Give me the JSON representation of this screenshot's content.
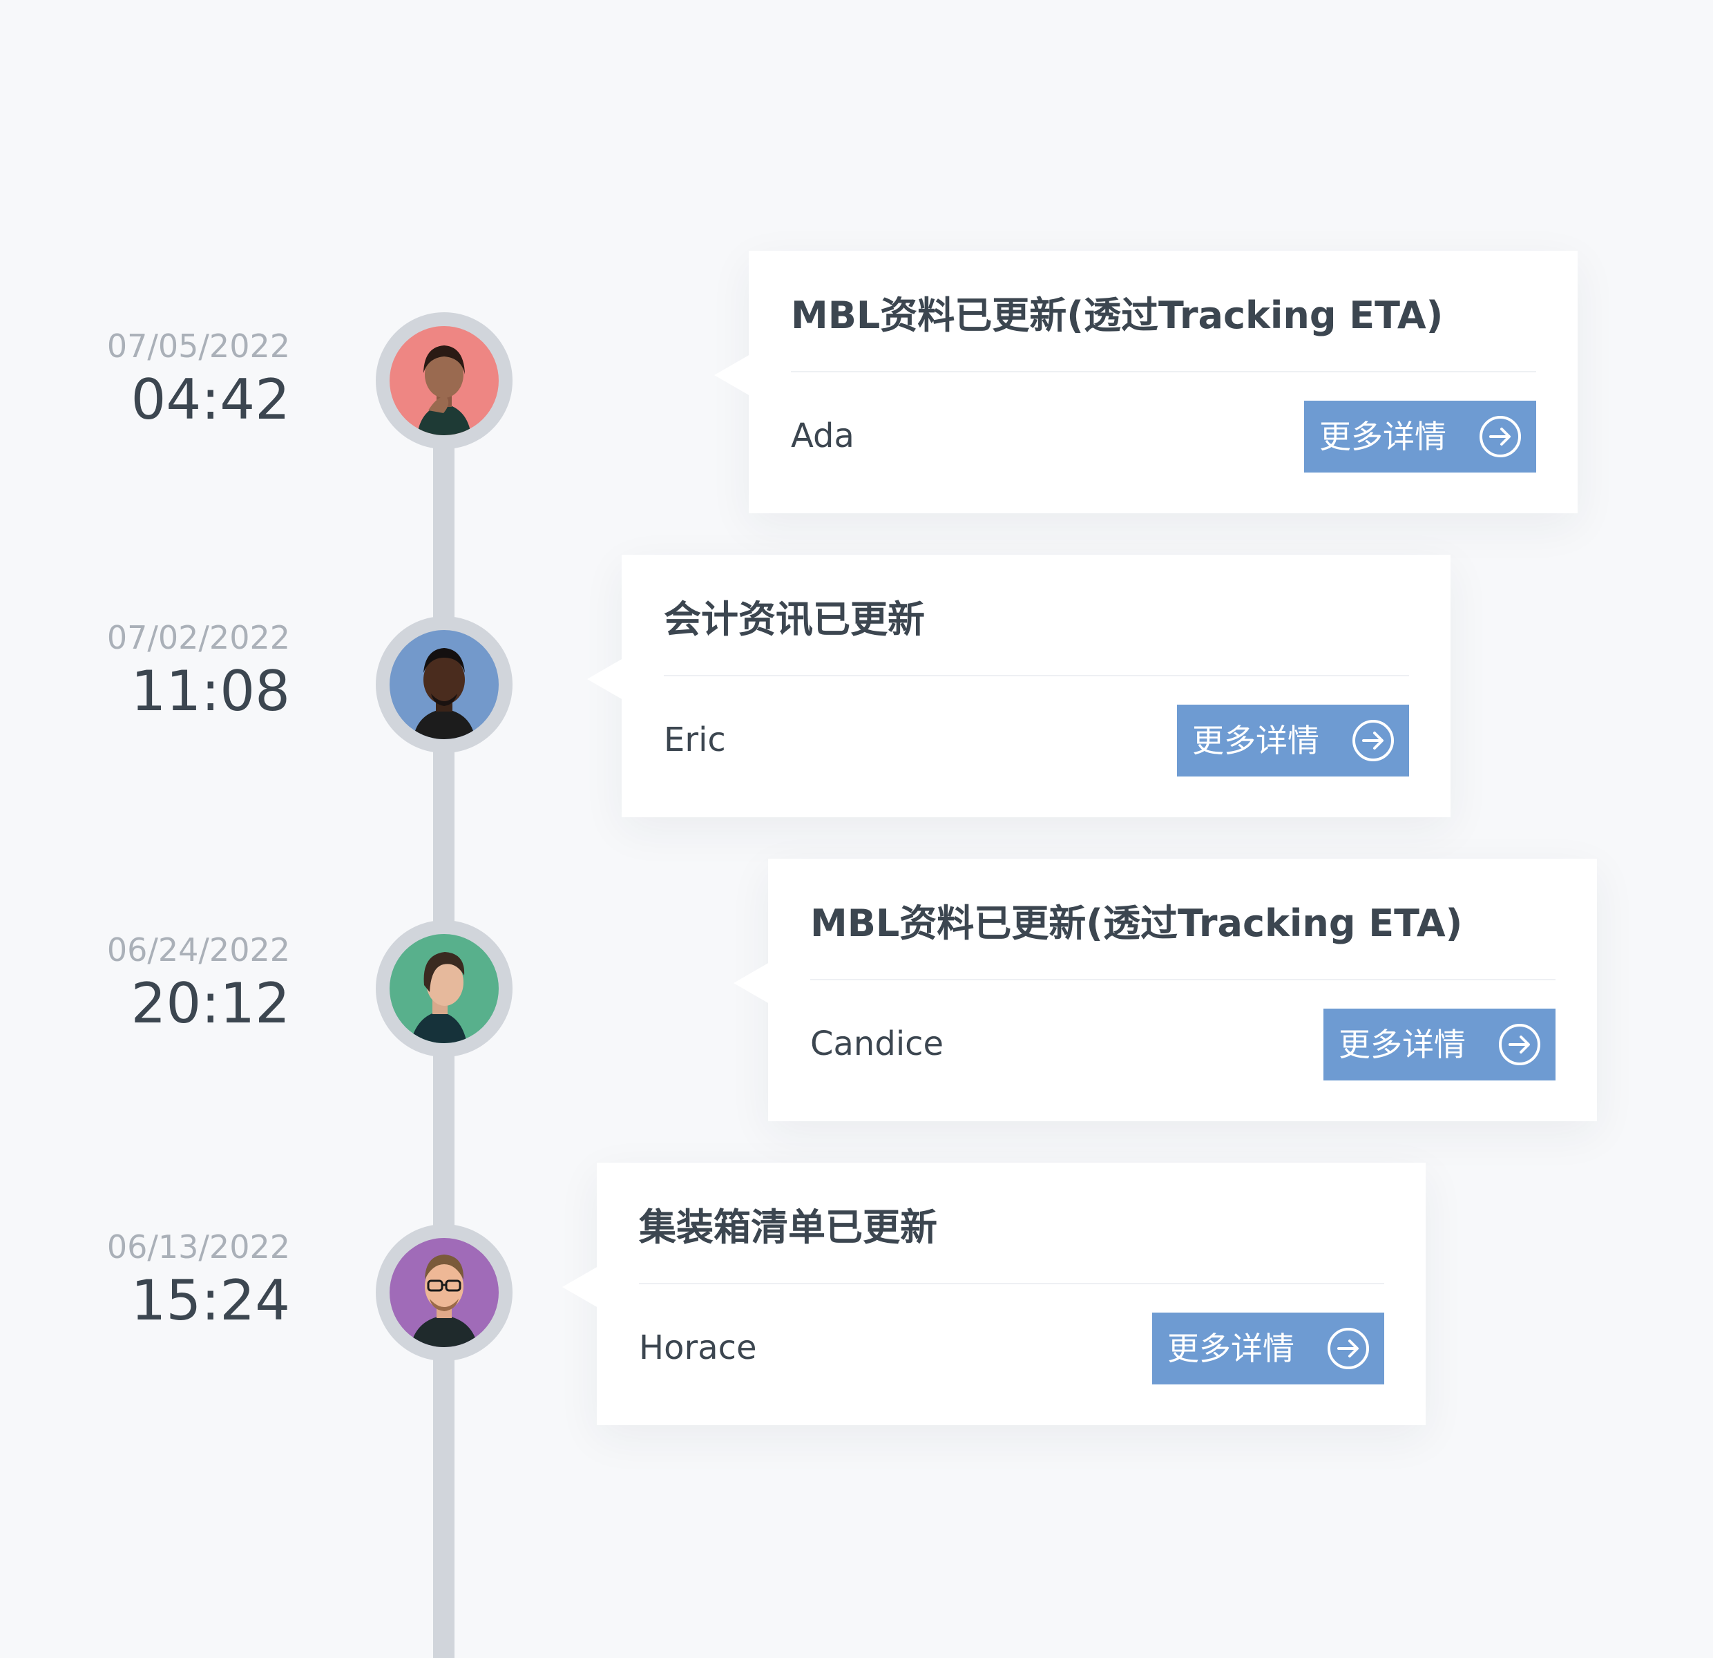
{
  "timeline": {
    "button_label": "更多详情",
    "entries": [
      {
        "date": "07/05/2022",
        "time": "04:42",
        "title": "MBL资料已更新(透过Tracking ETA)",
        "user": "Ada",
        "avatar_bg": "#ee8683"
      },
      {
        "date": "07/02/2022",
        "time": "11:08",
        "title": "会计资讯已更新",
        "user": "Eric",
        "avatar_bg": "#7399cb"
      },
      {
        "date": "06/24/2022",
        "time": "20:12",
        "title": "MBL资料已更新(透过Tracking ETA)",
        "user": "Candice",
        "avatar_bg": "#58b08c"
      },
      {
        "date": "06/13/2022",
        "time": "15:24",
        "title": "集装箱清单已更新",
        "user": "Horace",
        "avatar_bg": "#a06bb8"
      }
    ]
  },
  "colors": {
    "background": "#f7f8fa",
    "line": "#d1d5db",
    "button": "#6e9bd2",
    "text_dark": "#3c4650",
    "text_muted": "#aab0b8"
  },
  "icons": {
    "button_icon": "arrow-right-circle-icon"
  }
}
